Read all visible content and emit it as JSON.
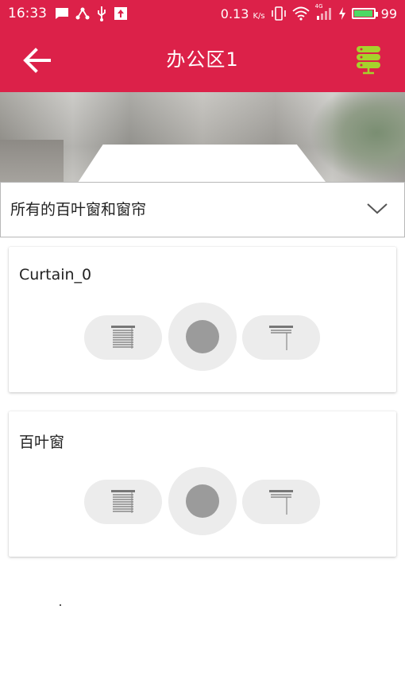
{
  "status_bar": {
    "time": "16:33",
    "data_rate": "0.13",
    "data_unit": "K/s",
    "network": "4G",
    "battery_level": "99",
    "battery_fraction": 0.99,
    "left_icons": [
      "message-icon",
      "share-icon",
      "usb-icon",
      "upload-icon"
    ],
    "right_icons": [
      "vibrate-icon",
      "wifi-icon",
      "signal-icon",
      "charging-icon",
      "battery-icon"
    ]
  },
  "app_bar": {
    "title": "办公区1",
    "back_icon": "back-arrow-icon",
    "server_icon": "server-icon",
    "color": "#dc2149",
    "server_icon_color": "#a6d22c"
  },
  "filter": {
    "selected": "所有的百叶窗和窗帘"
  },
  "devices": [
    {
      "name": "Curtain_0",
      "close_icon": "blind-closed-icon",
      "stop_icon": "stop-icon",
      "open_icon": "blind-open-icon"
    },
    {
      "name": "百叶窗",
      "close_icon": "blind-closed-icon",
      "stop_icon": "stop-icon",
      "open_icon": "blind-open-icon"
    }
  ]
}
